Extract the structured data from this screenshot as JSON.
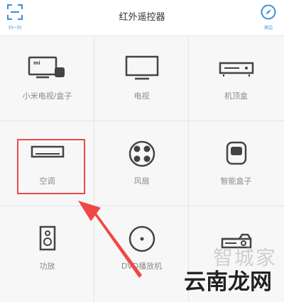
{
  "header": {
    "title": "红外遥控器",
    "scan_label": "扫一扫",
    "around_label": "周边"
  },
  "devices": [
    {
      "label": "小米电视/盒子",
      "icon": "mi-tv-box-icon"
    },
    {
      "label": "电视",
      "icon": "tv-icon"
    },
    {
      "label": "机顶盒",
      "icon": "set-top-box-icon"
    },
    {
      "label": "空调",
      "icon": "air-conditioner-icon"
    },
    {
      "label": "风扇",
      "icon": "fan-icon"
    },
    {
      "label": "智能盒子",
      "icon": "smart-box-icon"
    },
    {
      "label": "功放",
      "icon": "amplifier-icon"
    },
    {
      "label": "DVD播放机",
      "icon": "dvd-player-icon"
    },
    {
      "label": "",
      "icon": "projector-icon"
    }
  ],
  "watermark": {
    "line1": "智城家",
    "line2": "云南龙网"
  },
  "colors": {
    "accent": "#3b8ed8",
    "highlight": "#e54b4b",
    "icon": "#444444",
    "label": "#8a8a8a"
  }
}
